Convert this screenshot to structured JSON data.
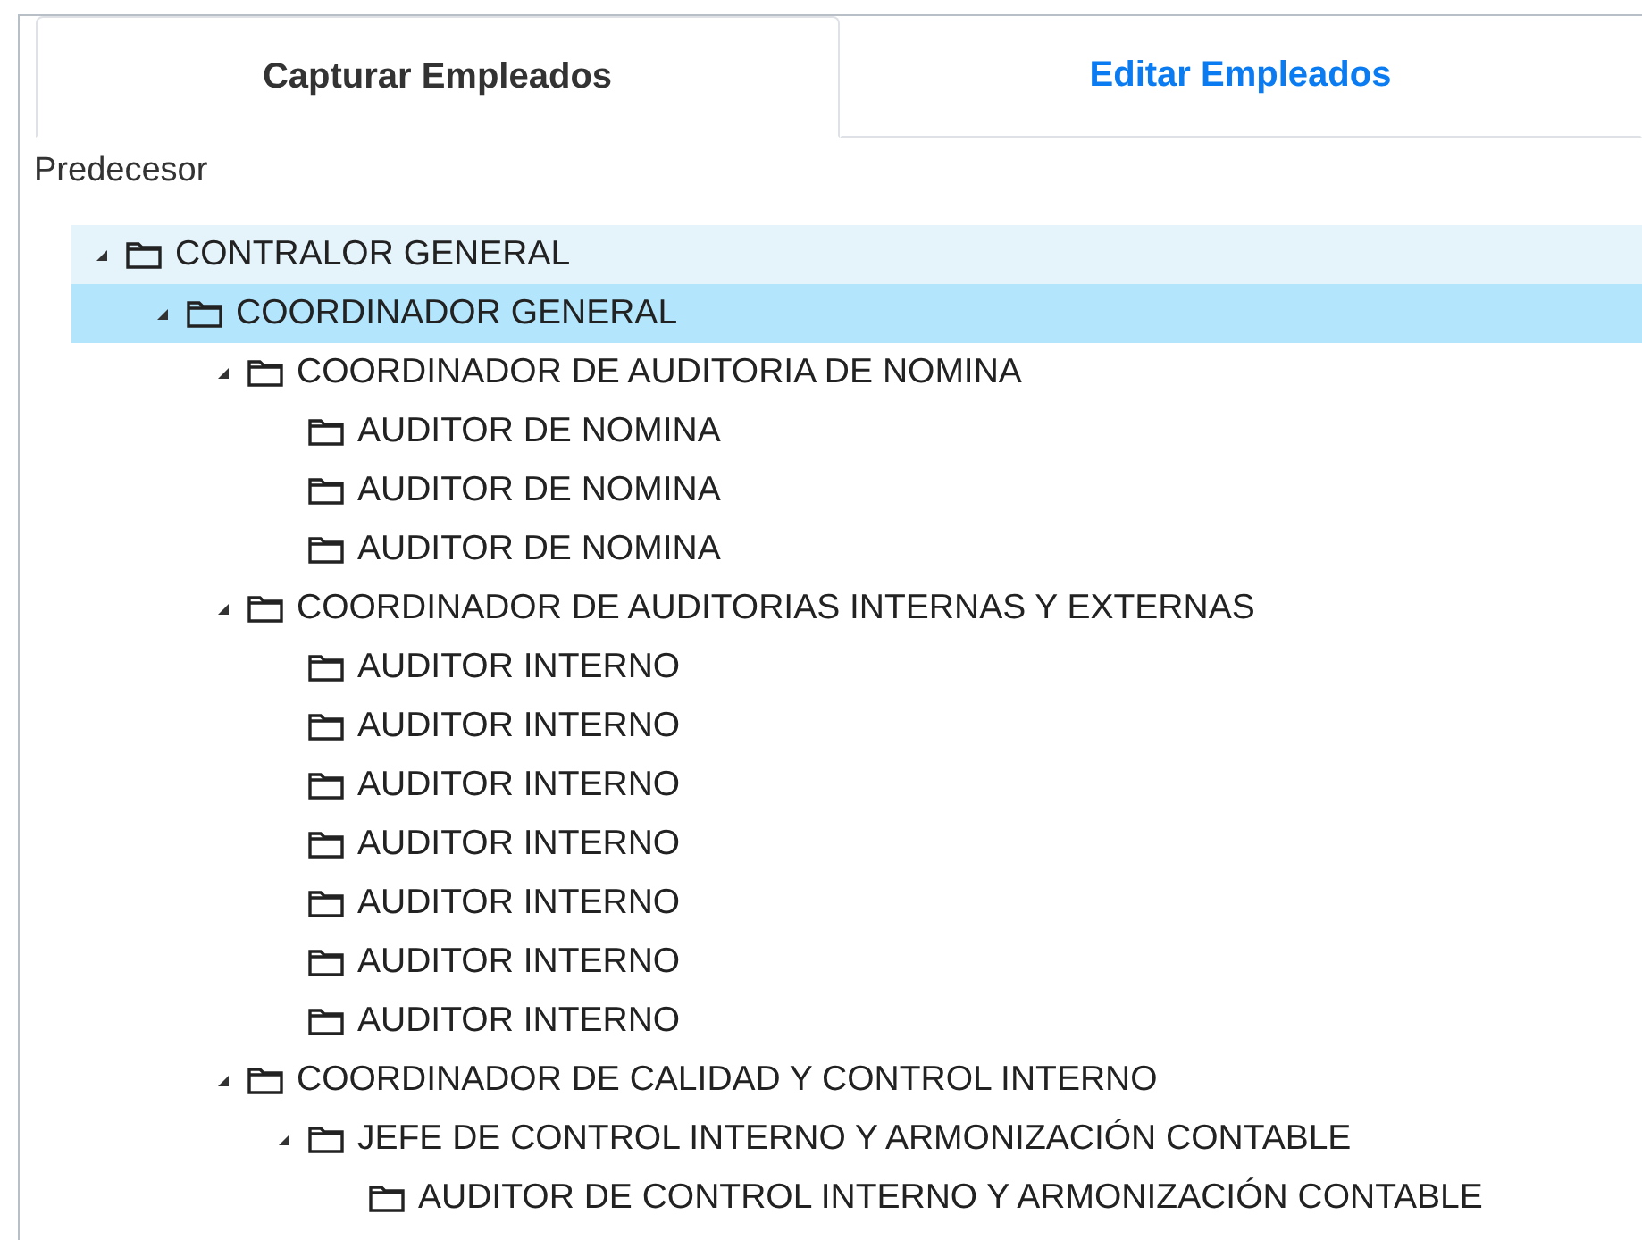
{
  "tabs": [
    {
      "label": "Capturar Empleados",
      "selected": true
    },
    {
      "label": "Editar Empleados",
      "selected": false
    }
  ],
  "field_label": "Predecesor",
  "tree": [
    {
      "label": "CONTRALOR GENERAL",
      "expanded": true,
      "selected": false,
      "hovered": true,
      "children": [
        {
          "label": "COORDINADOR GENERAL",
          "expanded": true,
          "selected": true,
          "hovered": false,
          "children": [
            {
              "label": "COORDINADOR DE AUDITORIA DE NOMINA",
              "expanded": true,
              "selected": false,
              "hovered": false,
              "children": [
                {
                  "label": "AUDITOR DE NOMINA",
                  "selected": false,
                  "hovered": false
                },
                {
                  "label": "AUDITOR DE NOMINA",
                  "selected": false,
                  "hovered": false
                },
                {
                  "label": "AUDITOR DE NOMINA",
                  "selected": false,
                  "hovered": false
                }
              ]
            },
            {
              "label": "COORDINADOR DE AUDITORIAS INTERNAS Y EXTERNAS",
              "expanded": true,
              "selected": false,
              "hovered": false,
              "children": [
                {
                  "label": "AUDITOR INTERNO",
                  "selected": false,
                  "hovered": false
                },
                {
                  "label": "AUDITOR INTERNO",
                  "selected": false,
                  "hovered": false
                },
                {
                  "label": "AUDITOR INTERNO",
                  "selected": false,
                  "hovered": false
                },
                {
                  "label": "AUDITOR INTERNO",
                  "selected": false,
                  "hovered": false
                },
                {
                  "label": "AUDITOR INTERNO",
                  "selected": false,
                  "hovered": false
                },
                {
                  "label": "AUDITOR INTERNO",
                  "selected": false,
                  "hovered": false
                },
                {
                  "label": "AUDITOR INTERNO",
                  "selected": false,
                  "hovered": false
                }
              ]
            },
            {
              "label": "COORDINADOR DE CALIDAD Y CONTROL INTERNO",
              "expanded": true,
              "selected": false,
              "hovered": false,
              "children": [
                {
                  "label": "JEFE DE CONTROL INTERNO Y ARMONIZACIÓN CONTABLE",
                  "expanded": true,
                  "selected": false,
                  "hovered": false,
                  "children": [
                    {
                      "label": "AUDITOR DE CONTROL INTERNO Y ARMONIZACIÓN CONTABLE",
                      "selected": false,
                      "hovered": false
                    }
                  ]
                }
              ]
            }
          ]
        }
      ]
    }
  ]
}
